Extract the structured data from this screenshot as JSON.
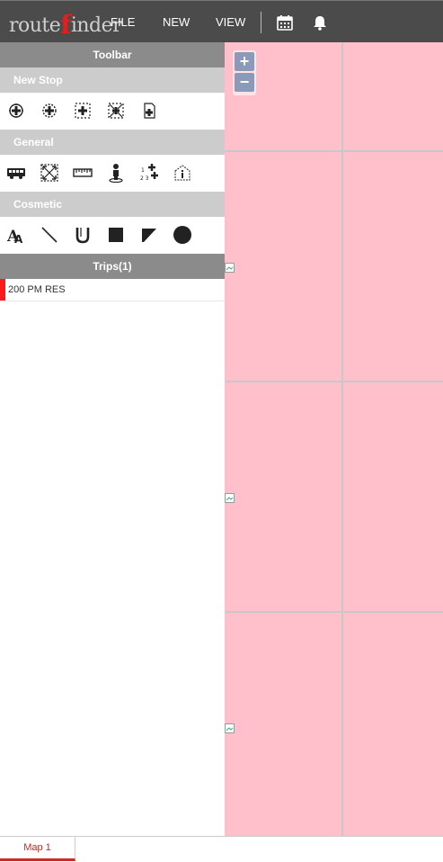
{
  "app": {
    "logo_prefix": "route",
    "logo_f": "f",
    "logo_suffix": "inder"
  },
  "menu": {
    "file": "FILE",
    "new": "NEW",
    "view": "VIEW",
    "icons": [
      "calendar-icon",
      "bell-icon"
    ]
  },
  "sidebar": {
    "toolbar_title": "Toolbar",
    "sections": {
      "new_stop": {
        "title": "New Stop",
        "tools": [
          "add-stop-icon",
          "add-stop-radius-icon",
          "add-stop-square-icon",
          "add-stop-region-icon",
          "add-stop-page-icon"
        ]
      },
      "general": {
        "title": "General",
        "tools": [
          "bus-icon",
          "zoom-extent-icon",
          "measure-ruler-icon",
          "person-location-icon",
          "numbered-stops-icon",
          "info-house-icon"
        ]
      },
      "cosmetic": {
        "title": "Cosmetic",
        "tools": [
          "text-tool-icon",
          "line-tool-icon",
          "underline-tool-icon",
          "rectangle-tool-icon",
          "polygon-tool-icon",
          "circle-tool-icon"
        ],
        "text_tool_glyph": "A"
      }
    },
    "trips_title": "Trips(1)",
    "trips": [
      {
        "name": "200 PM RES",
        "color": "#ff1a1a"
      }
    ]
  },
  "map": {
    "background": "#ffc0cb",
    "zoom_in": "+",
    "zoom_out": "−"
  },
  "bottom": {
    "tab_label": "Map 1",
    "accent": "#cc2a2a"
  }
}
